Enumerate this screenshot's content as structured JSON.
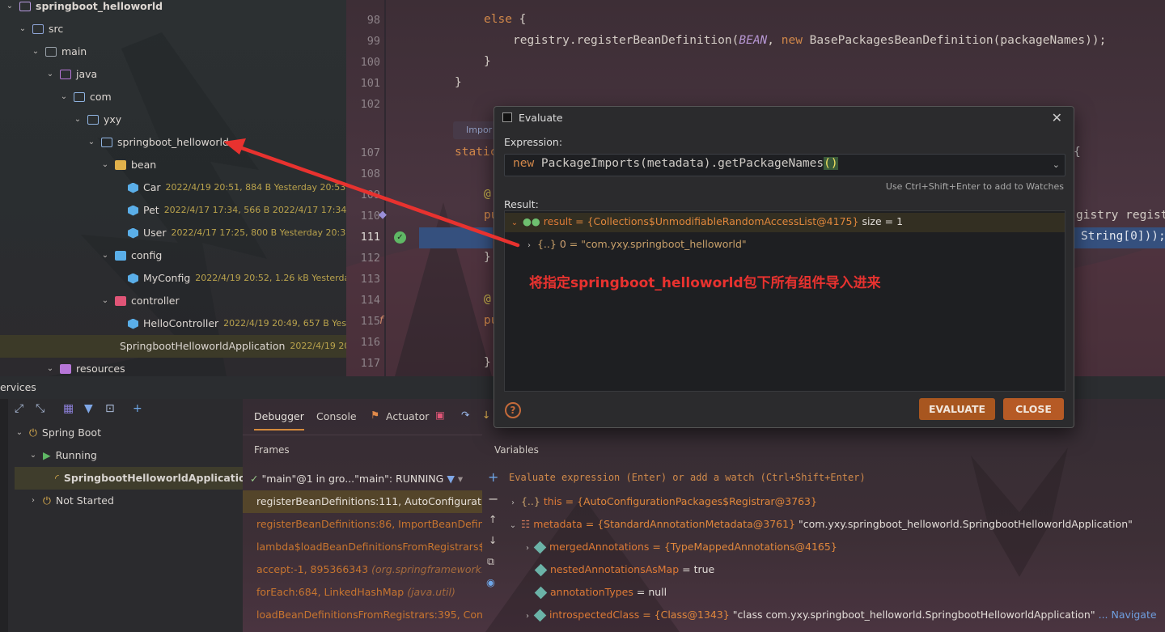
{
  "project": {
    "root": "springboot_helloworld",
    "src": "src",
    "main": "main",
    "java": "java",
    "com": "com",
    "yxy": "yxy",
    "pkg": "springboot_helloworld",
    "bean": "bean",
    "car": {
      "name": "Car",
      "meta": "2022/4/19 20:51, 884 B Yesterday 20:53"
    },
    "pet": {
      "name": "Pet",
      "meta": "2022/4/17 17:34, 566 B 2022/4/17 17:34"
    },
    "user": {
      "name": "User",
      "meta": "2022/4/17 17:25, 800 B Yesterday 20:30"
    },
    "config": "config",
    "myconfig": {
      "name": "MyConfig",
      "meta": "2022/4/19 20:52, 1.26 kB Yesterday 2"
    },
    "controller": "controller",
    "hello": {
      "name": "HelloController",
      "meta": "2022/4/19 20:49, 657 B Yesterd"
    },
    "app": {
      "name": "SpringbootHelloworldApplication",
      "meta": "2022/4/19 20"
    },
    "resources": "resources"
  },
  "editor": {
    "lines": [
      "98",
      "99",
      "100",
      "101",
      "102",
      "107",
      "108",
      "109",
      "110",
      "111",
      "112",
      "113",
      "114",
      "115",
      "116",
      "117"
    ],
    "else_kw": "else",
    "brace_open": "{",
    "reg_call": "registry.registerBeanDefinition(",
    "bean_const": "BEAN",
    "comma": ", ",
    "new_kw": "new",
    "reg_rest": " BasePackagesBeanDefinition(packageNames));",
    "close_brace": "}",
    "import_hint": "Impor",
    "static_kw": "static",
    "right_open": "{",
    "at": "@",
    "pu": "pu",
    "right_frag": "gistry regist",
    "sel_frag": "String[0]));"
  },
  "dialog": {
    "title": "Evaluate",
    "expression_label": "Expression:",
    "expr_new": "new",
    "expr_rest": " PackageImports(metadata).getPackageNames",
    "expr_parens": "()",
    "hint": "Use Ctrl+Shift+Enter to add to Watches",
    "result_label": "Result:",
    "result_name": "result",
    "result_value": "= {Collections$UnmodifiableRandomAccessList@4175}",
    "result_size": "size = 1",
    "child_name": "0",
    "child_value": "= \"com.yxy.springboot_helloworld\"",
    "annotation": "将指定springboot_helloworld包下所有组件导入进来",
    "evaluate_button": "EVALUATE",
    "close_button": "CLOSE"
  },
  "services": {
    "title": "ervices",
    "spring_boot": "Spring Boot",
    "running": "Running",
    "app": "SpringbootHelloworldApplication",
    "not_started": "Not Started"
  },
  "debugger": {
    "tabs": [
      "Debugger",
      "Console",
      "Actuator"
    ],
    "frames_title": "Frames",
    "variables_title": "Variables",
    "thread": "\"main\"@1 in gro...\"main\": RUNNING",
    "frames": [
      {
        "text": "registerBeanDefinitions:111, AutoConfigurationPa",
        "pkg": ""
      },
      {
        "text": "registerBeanDefinitions:86, ImportBeanDefinition",
        "pkg": ""
      },
      {
        "text": "lambda$loadBeanDefinitionsFromRegistrars$1:3",
        "pkg": ""
      },
      {
        "text": "accept:-1, 895366343 ",
        "pkg": "(org.springframework.con"
      },
      {
        "text": "forEach:684, LinkedHashMap ",
        "pkg": "(java.util)"
      },
      {
        "text": "loadBeanDefinitionsFromRegistrars:395, Configu",
        "pkg": ""
      }
    ],
    "eval_hint": "Evaluate expression (Enter) or add a watch (Ctrl+Shift+Enter)",
    "vars": [
      {
        "name": "this",
        "value": "= {AutoConfigurationPackages$Registrar@3763}",
        "extra": ""
      },
      {
        "name": "metadata",
        "value": "= {StandardAnnotationMetadata@3761}",
        "extra": " \"com.yxy.springboot_helloworld.SpringbootHelloworldApplication\""
      },
      {
        "name": "mergedAnnotations",
        "value": "= {TypeMappedAnnotations@4165}",
        "extra": ""
      },
      {
        "name": "nestedAnnotationsAsMap",
        "value": "= true",
        "extra": ""
      },
      {
        "name": "annotationTypes",
        "value": "= null",
        "extra": ""
      },
      {
        "name": "introspectedClass",
        "value": "= {Class@1343}",
        "extra": " \"class com.yxy.springboot_helloworld.SpringbootHelloworldApplication\""
      }
    ],
    "navigate": "... Navigate"
  }
}
